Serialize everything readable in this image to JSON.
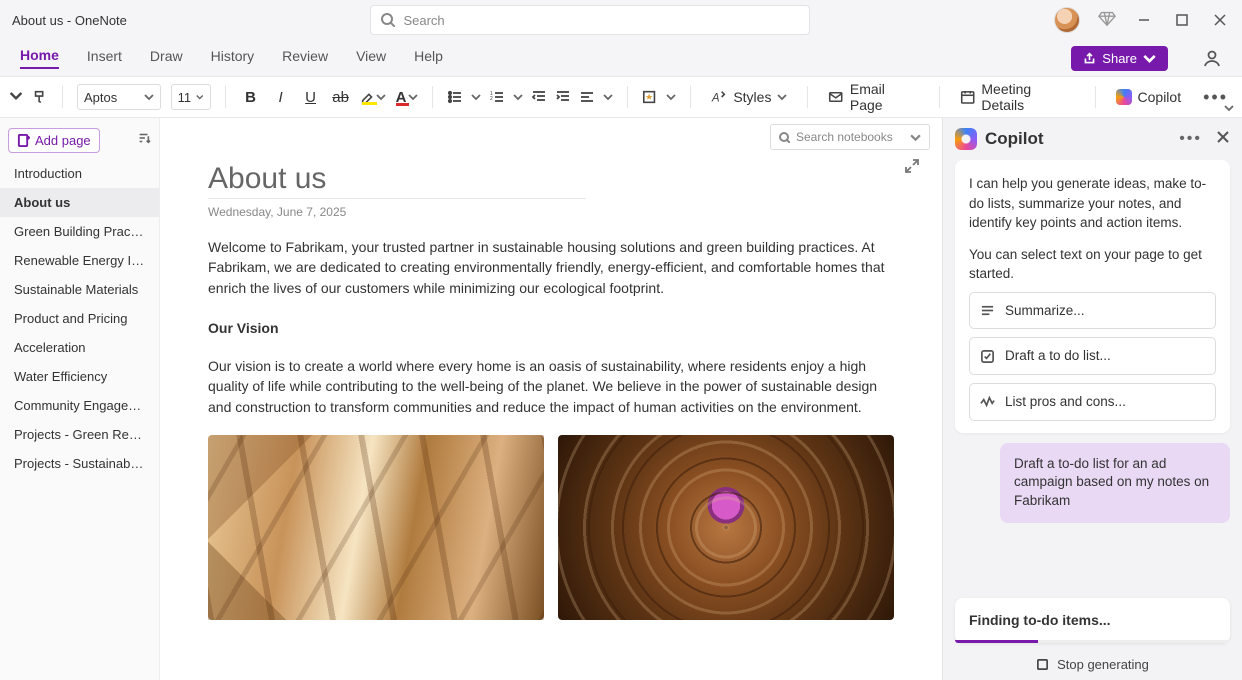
{
  "window": {
    "title": "About us - OneNote"
  },
  "search": {
    "placeholder": "Search"
  },
  "tabs": {
    "items": [
      "Home",
      "Insert",
      "Draw",
      "History",
      "Review",
      "View",
      "Help"
    ],
    "active": 0,
    "share_label": "Share"
  },
  "toolbar": {
    "font": "Aptos",
    "size": "11",
    "styles_label": "Styles",
    "email_label": "Email Page",
    "meeting_label": "Meeting Details",
    "copilot_label": "Copilot"
  },
  "notebook_search": {
    "placeholder": "Search notebooks"
  },
  "pages": {
    "add_label": "Add page",
    "items": [
      "Introduction",
      "About us",
      "Green Building Practices",
      "Renewable Energy Integr...",
      "Sustainable Materials",
      "Product and Pricing",
      "Acceleration",
      "Water Efficiency",
      "Community Engagement",
      "Projects - Green Resident...",
      "Projects - Sustainable Mu..."
    ],
    "active": 1
  },
  "doc": {
    "title": "About us",
    "date": "Wednesday, June 7, 2025",
    "p1": "Welcome to Fabrikam, your trusted partner in sustainable housing solutions and green building practices. At Fabrikam, we are dedicated to creating environmentally friendly, energy-efficient, and comfortable homes that enrich the lives of our customers while minimizing our ecological footprint.",
    "h2": "Our Vision",
    "p2": "Our vision is to create a world where every home is an oasis of sustainability, where residents enjoy a high quality of life while contributing to the well-being of the planet. We believe in the power of sustainable design and construction to transform communities and reduce the impact of human activities on the environment."
  },
  "copilot": {
    "title": "Copilot",
    "intro1": "I can help you generate ideas, make to-do lists, summarize your notes, and identify key points and action items.",
    "intro2": "You can select text on your page to get started.",
    "suggestions": [
      "Summarize...",
      "Draft a to do list...",
      "List pros and cons..."
    ],
    "user_message": "Draft a to-do list for an ad campaign based on my notes on Fabrikam",
    "status": "Finding to-do items...",
    "stop_label": "Stop generating"
  }
}
